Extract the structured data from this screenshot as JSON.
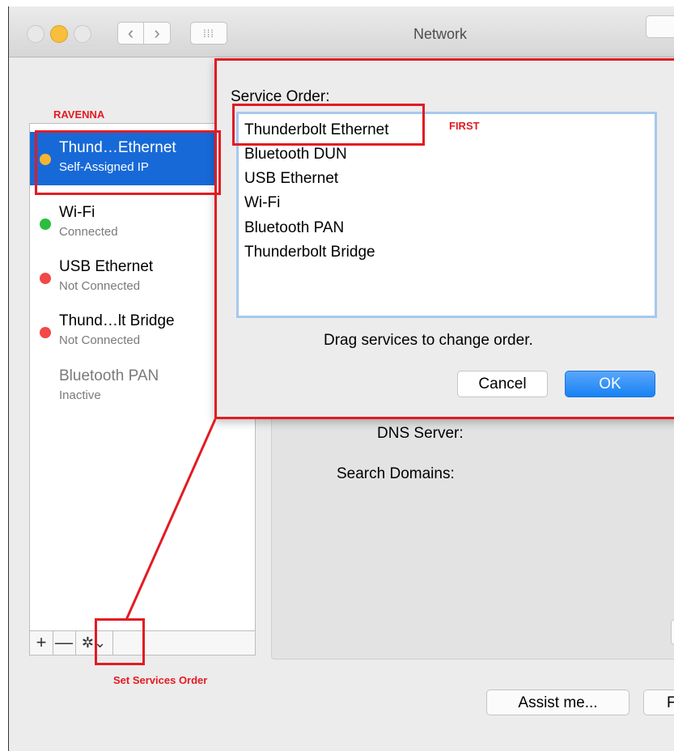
{
  "window": {
    "title": "Network",
    "nav_back": "‹",
    "nav_forward": "›",
    "grid_icon": "⁞⁞⁞"
  },
  "sidebar": {
    "group_label": "RAVENNA",
    "services": [
      {
        "name": "Thund…Ethernet",
        "status": "Self-Assigned IP",
        "dot_color": "#f5b530",
        "selected": true
      },
      {
        "name": "Wi-Fi",
        "status": "Connected",
        "dot_color": "#2cbd3f",
        "selected": false
      },
      {
        "name": "USB Ethernet",
        "status": "Not Connected",
        "dot_color": "#f24848",
        "selected": false
      },
      {
        "name": "Thund…lt Bridge",
        "status": "Not Connected",
        "dot_color": "#f24848",
        "selected": false
      },
      {
        "name": "Bluetooth PAN",
        "status": "Inactive",
        "dot_color": "",
        "selected": false
      }
    ],
    "toolbar": {
      "add": "+",
      "remove": "—",
      "gear": "✲⌄"
    }
  },
  "details": {
    "dns_label": "DNS Server:",
    "search_domains_label": "Search Domains:"
  },
  "sheet": {
    "title": "Service Order:",
    "order": [
      "Thunderbolt Ethernet",
      "Bluetooth DUN",
      "USB Ethernet",
      "Wi-Fi",
      "Bluetooth PAN",
      "Thunderbolt Bridge"
    ],
    "hint": "Drag services to change order.",
    "cancel": "Cancel",
    "ok": "OK"
  },
  "footer": {
    "assist": "Assist me...",
    "revert_partial": "F"
  },
  "annotations": {
    "first": "FIRST",
    "set_order": "Set Services Order",
    "highlight_color": "#e21b23"
  }
}
